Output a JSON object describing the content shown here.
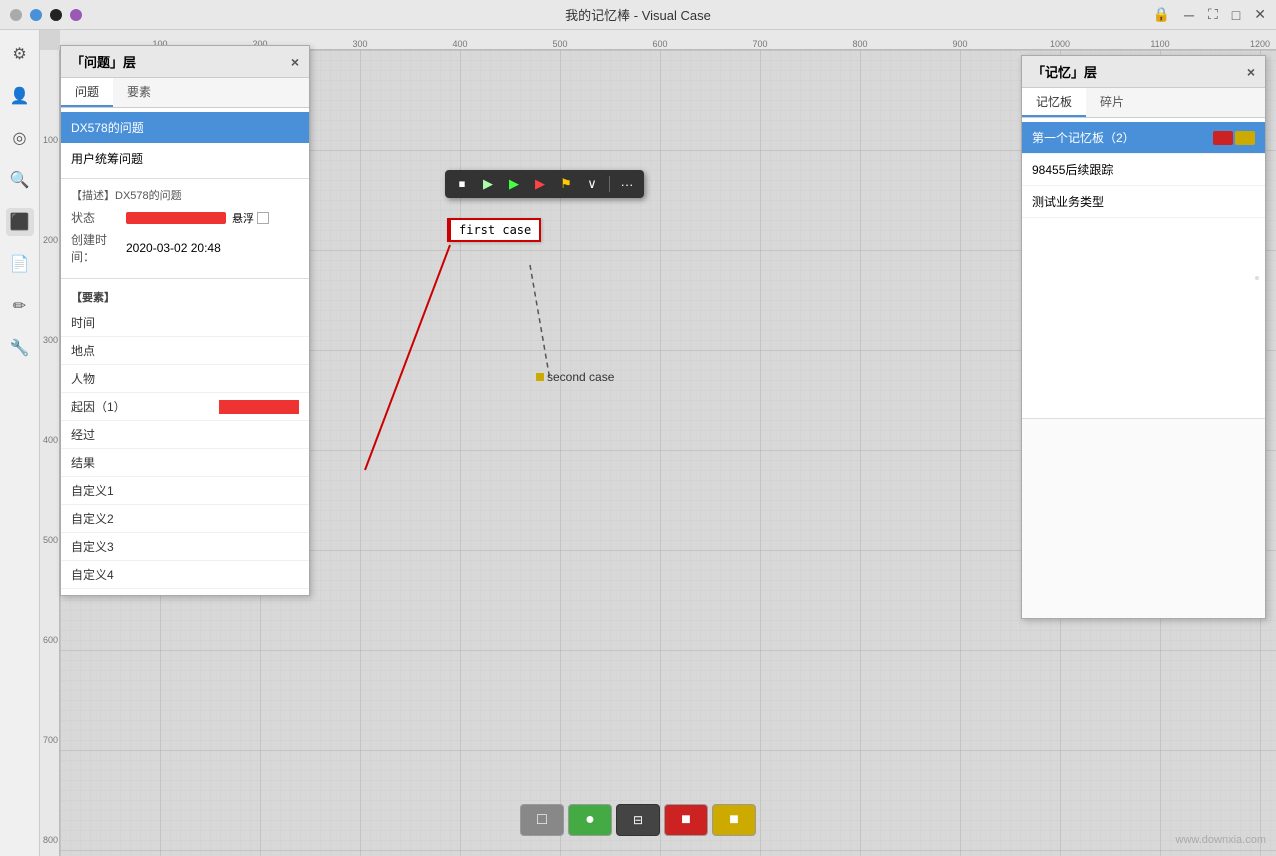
{
  "window": {
    "title": "我的记忆棒 - Visual Case",
    "close_btn": "✕",
    "minimize_btn": "─",
    "maximize_btn": "□",
    "fullscreen_btn": "⛶"
  },
  "traffic_lights": {
    "gray": "#aaaaaa",
    "blue": "#4a90d9",
    "black": "#222222",
    "purple": "#9b59b6"
  },
  "left_sidebar": {
    "icons": [
      "⚙",
      "👤",
      "⊙",
      "🔍",
      "📋",
      "📄",
      "📝",
      "🔧"
    ]
  },
  "problem_panel": {
    "title": "「问题」层",
    "close": "×",
    "tabs": [
      "问题",
      "要素"
    ],
    "active_tab": "问题",
    "items": [
      {
        "label": "DX578的问题",
        "selected": true
      },
      {
        "label": "用户统筹问题",
        "selected": false
      }
    ],
    "desc_title": "【描述】DX578的问题",
    "status_label": "状态",
    "floating_label": "悬浮",
    "created_label": "创建时间：",
    "created_value": "2020-03-02 20:48",
    "elements_title": "【要素】",
    "elements": [
      {
        "label": "时间",
        "value": ""
      },
      {
        "label": "地点",
        "value": ""
      },
      {
        "label": "人物",
        "value": ""
      },
      {
        "label": "起因（1）",
        "value": "red-bar"
      },
      {
        "label": "经过",
        "value": ""
      },
      {
        "label": "结果",
        "value": ""
      },
      {
        "label": "自定义1",
        "value": ""
      },
      {
        "label": "自定义2",
        "value": ""
      },
      {
        "label": "自定义3",
        "value": ""
      },
      {
        "label": "自定义4",
        "value": ""
      }
    ]
  },
  "toolbar": {
    "buttons": [
      "⏹",
      "▶",
      "▶",
      "▶",
      "⚑",
      "∨",
      "···"
    ]
  },
  "canvas": {
    "first_case_label": "first case",
    "second_case_label": "second case"
  },
  "memory_panel": {
    "title": "「记忆」层",
    "close": "×",
    "tabs": [
      "记忆板",
      "碎片"
    ],
    "active_tab": "记忆板",
    "items": [
      {
        "label": "第一个记忆板（2）",
        "selected": true,
        "colors": [
          "#cc2222",
          "#ccaa00"
        ]
      },
      {
        "label": "98455后续跟踪",
        "selected": false,
        "colors": []
      },
      {
        "label": "测试业务类型",
        "selected": false,
        "colors": []
      }
    ]
  },
  "bottom_toolbar": {
    "buttons": [
      {
        "color": "gray",
        "label": "□"
      },
      {
        "color": "green",
        "label": "●"
      },
      {
        "color": "dark",
        "label": "⊟"
      },
      {
        "color": "red",
        "label": "■"
      },
      {
        "color": "yellow",
        "label": "■"
      }
    ]
  },
  "ruler": {
    "h_marks": [
      100,
      200,
      300,
      400,
      500,
      600,
      700,
      800,
      900,
      1000,
      1100,
      1200
    ],
    "v_marks": [
      100,
      200,
      300,
      400,
      500,
      600,
      700,
      800
    ]
  },
  "watermark": "www.downxia.com"
}
